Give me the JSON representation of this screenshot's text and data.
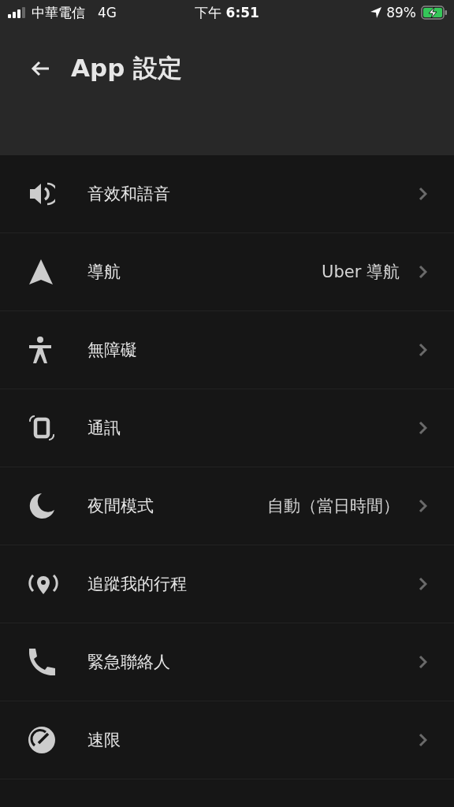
{
  "status_bar": {
    "carrier": "中華電信",
    "network": "4G",
    "time": "下午 **6:51**",
    "battery": "89%"
  },
  "header": {
    "title": "App 設定"
  },
  "settings": [
    {
      "kind": "sound",
      "label": "音效和語音"
    },
    {
      "kind": "navigation",
      "label": "導航",
      "value": "Uber 導航"
    },
    {
      "kind": "accessibility",
      "label": "無障礙"
    },
    {
      "kind": "communication",
      "label": "通訊"
    },
    {
      "kind": "night",
      "label": "夜間模式",
      "value": "自動（當日時間）"
    },
    {
      "kind": "tracking",
      "label": "追蹤我的行程"
    },
    {
      "kind": "phone",
      "label": "緊急聯絡人"
    },
    {
      "kind": "speed",
      "label": "速限"
    }
  ]
}
